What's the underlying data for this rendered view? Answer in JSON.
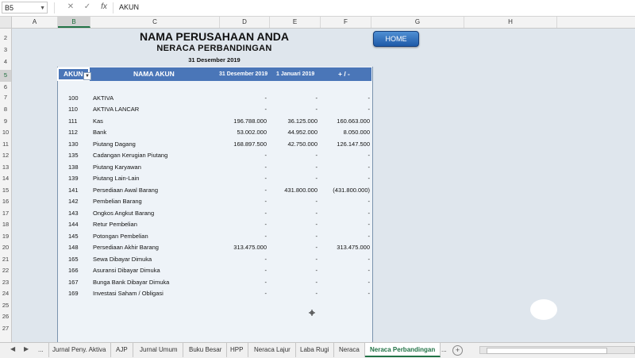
{
  "formula_bar": {
    "cell_ref": "B5",
    "cancel_icon": "✕",
    "enter_icon": "✓",
    "fx_label": "fx",
    "value": "AKUN"
  },
  "columns": [
    "A",
    "B",
    "C",
    "D",
    "E",
    "F",
    "G",
    "H"
  ],
  "selected_column": "B",
  "rows": [
    "2",
    "3",
    "4",
    "5",
    "6",
    "7",
    "8",
    "9",
    "10",
    "11",
    "12",
    "13",
    "14",
    "15",
    "16",
    "17",
    "18",
    "19",
    "20",
    "21",
    "22",
    "23",
    "24",
    "25",
    "26",
    "27"
  ],
  "selected_row": "5",
  "report": {
    "company": "NAMA PERUSAHAAN ANDA",
    "title": "NERACA PERBANDINGAN",
    "date": "31 Desember 2019",
    "home_button": "HOME",
    "headers": {
      "akun": "AKUN",
      "nama_akun": "NAMA AKUN",
      "col_d": "31 Desember 2019",
      "col_e": "1 Januari 2019",
      "col_f": "+ / -"
    },
    "accounts": [
      {
        "code": "100",
        "name": "AKTIVA",
        "d": "-",
        "e": "-",
        "f": "-"
      },
      {
        "code": "110",
        "name": "AKTIVA LANCAR",
        "d": "-",
        "e": "-",
        "f": "-"
      },
      {
        "code": "111",
        "name": "Kas",
        "d": "196.788.000",
        "e": "36.125.000",
        "f": "160.663.000"
      },
      {
        "code": "112",
        "name": "Bank",
        "d": "53.002.000",
        "e": "44.952.000",
        "f": "8.050.000"
      },
      {
        "code": "130",
        "name": "Piutang Dagang",
        "d": "168.897.500",
        "e": "42.750.000",
        "f": "126.147.500"
      },
      {
        "code": "135",
        "name": "Cadangan Kerugian Piutang",
        "d": "-",
        "e": "-",
        "f": "-"
      },
      {
        "code": "138",
        "name": "Piutang Karyawan",
        "d": "-",
        "e": "-",
        "f": "-"
      },
      {
        "code": "139",
        "name": "Piutang Lain-Lain",
        "d": "-",
        "e": "-",
        "f": "-"
      },
      {
        "code": "141",
        "name": "Persediaan Awal Barang",
        "d": "-",
        "e": "431.800.000",
        "f": "(431.800.000)"
      },
      {
        "code": "142",
        "name": "Pembelian Barang",
        "d": "-",
        "e": "-",
        "f": "-"
      },
      {
        "code": "143",
        "name": "Ongkos Angkut Barang",
        "d": "-",
        "e": "-",
        "f": "-"
      },
      {
        "code": "144",
        "name": "Retur Pembelian",
        "d": "-",
        "e": "-",
        "f": "-"
      },
      {
        "code": "145",
        "name": "Potongan Pembelian",
        "d": "-",
        "e": "-",
        "f": "-"
      },
      {
        "code": "148",
        "name": "Persediaan Akhir Barang",
        "d": "313.475.000",
        "e": "-",
        "f": "313.475.000"
      },
      {
        "code": "165",
        "name": "Sewa Dibayar Dimuka",
        "d": "-",
        "e": "-",
        "f": "-"
      },
      {
        "code": "166",
        "name": "Asuransi Dibayar Dimuka",
        "d": "-",
        "e": "-",
        "f": "-"
      },
      {
        "code": "167",
        "name": "Bunga Bank Dibayar Dimuka",
        "d": "-",
        "e": "-",
        "f": "-"
      },
      {
        "code": "169",
        "name": "Investasi Saham / Obligasi",
        "d": "-",
        "e": "-",
        "f": "-"
      }
    ]
  },
  "sheet_tabs": {
    "items": [
      "...",
      "Jurnal Peny. Aktiva",
      "AJP",
      "Jurnal Umum",
      "Buku Besar",
      "HPP",
      "Neraca Lajur",
      "Laba Rugi",
      "Neraca",
      "Neraca Perbandingan",
      "..."
    ],
    "active": "Neraca Perbandingan",
    "add_icon": "+"
  }
}
